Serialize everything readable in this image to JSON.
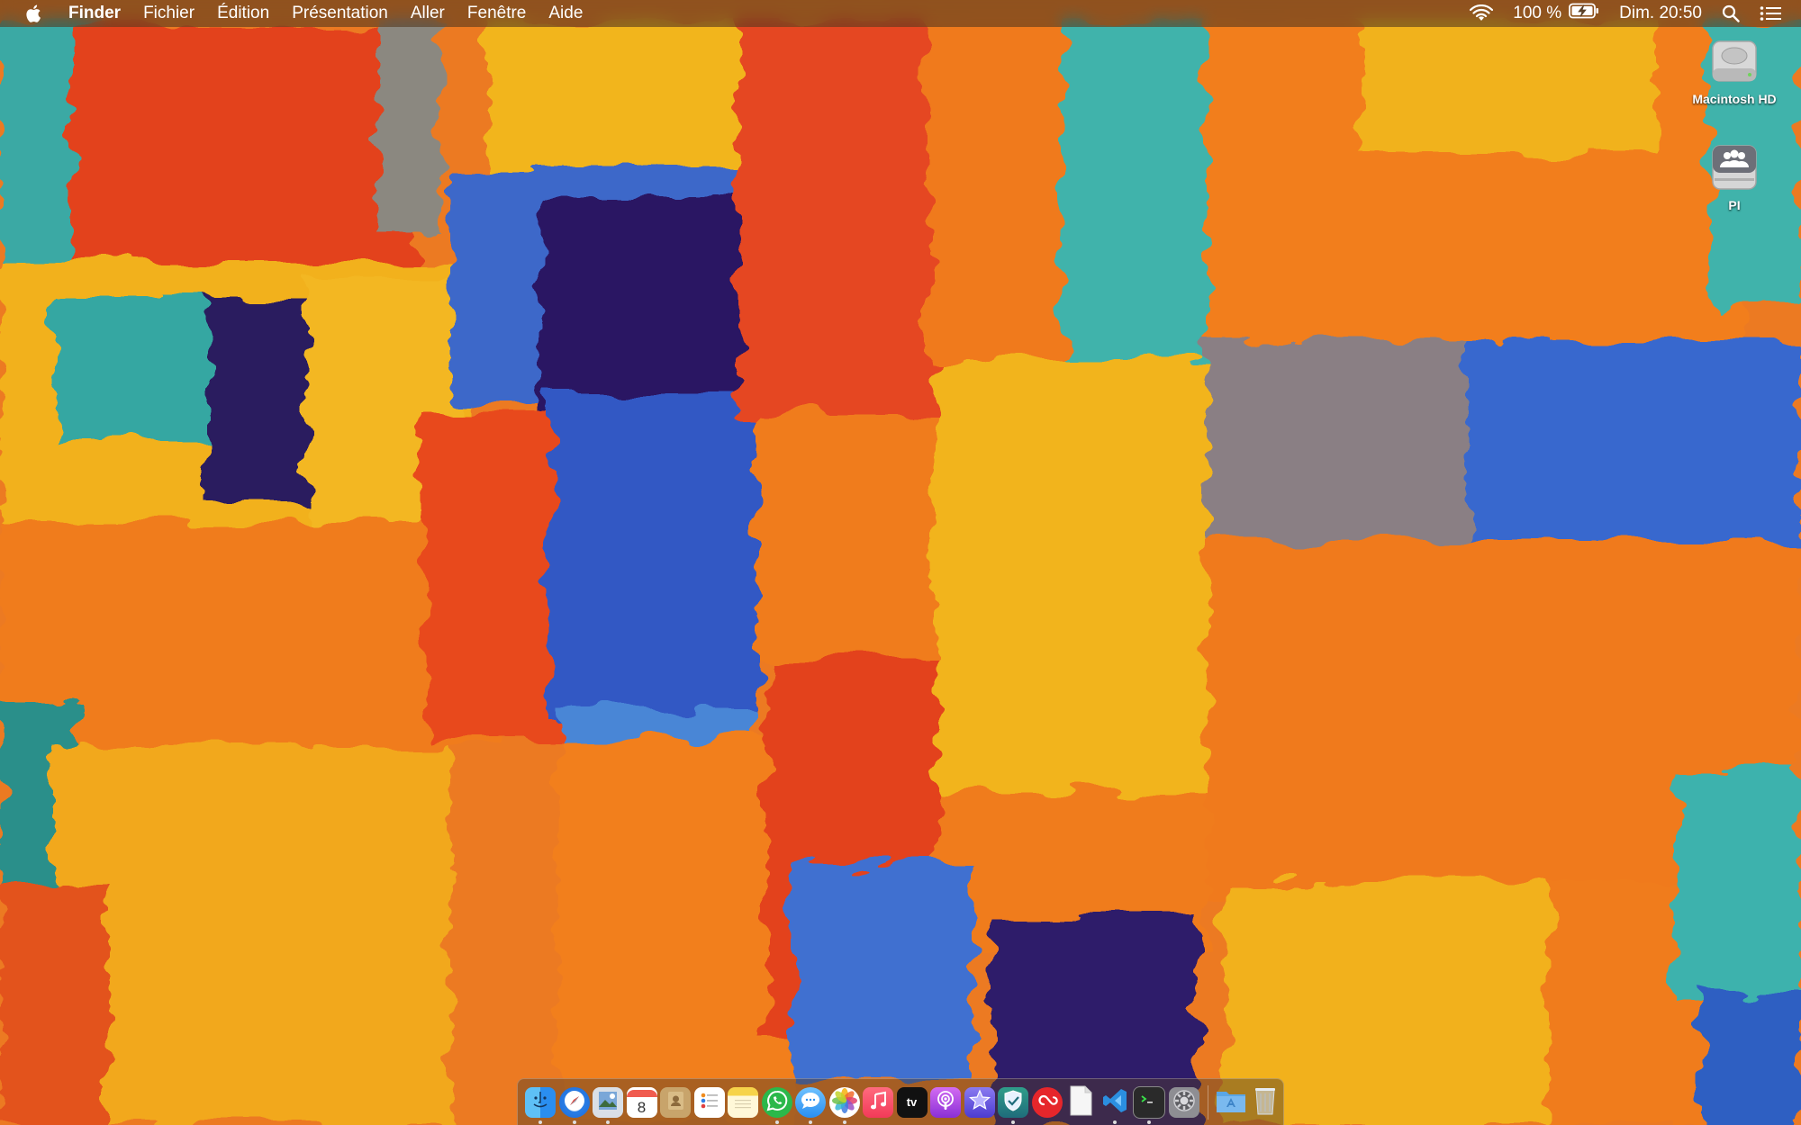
{
  "menubar": {
    "app_name": "Finder",
    "items": [
      "Fichier",
      "Édition",
      "Présentation",
      "Aller",
      "Fenêtre",
      "Aide"
    ],
    "battery_percent": "100 %",
    "datetime": "Dim. 20:50"
  },
  "desktop": {
    "icons": [
      {
        "label": "Macintosh HD",
        "icon": "hard-drive-icon"
      },
      {
        "label": "PI",
        "icon": "network-share-icon"
      }
    ]
  },
  "dock": {
    "apps": [
      {
        "icon": "finder-icon",
        "running": true
      },
      {
        "icon": "safari-icon",
        "running": true
      },
      {
        "icon": "preview-icon",
        "running": true
      },
      {
        "icon": "calendar-icon",
        "running": false,
        "text": "8"
      },
      {
        "icon": "contacts-icon",
        "running": false
      },
      {
        "icon": "reminders-icon",
        "running": false
      },
      {
        "icon": "notes-icon",
        "running": false
      },
      {
        "icon": "whatsapp-icon",
        "running": true
      },
      {
        "icon": "messages-icon",
        "running": true
      },
      {
        "icon": "photos-icon",
        "running": true
      },
      {
        "icon": "music-icon",
        "running": false
      },
      {
        "icon": "apple-tv-icon",
        "running": false,
        "text": "tv"
      },
      {
        "icon": "podcasts-icon",
        "running": false
      },
      {
        "icon": "imovie-icon",
        "running": false
      },
      {
        "icon": "vpn-shield-icon",
        "running": true
      },
      {
        "icon": "creative-cloud-icon",
        "running": false
      },
      {
        "icon": "text-file-icon",
        "running": false
      },
      {
        "icon": "vscode-icon",
        "running": true
      },
      {
        "icon": "terminal-icon",
        "running": true
      },
      {
        "icon": "system-preferences-icon",
        "running": false
      }
    ],
    "trailing": [
      {
        "icon": "applications-folder-icon"
      },
      {
        "icon": "trash-icon"
      }
    ]
  },
  "colors": {
    "orange": "#f07a1a",
    "red": "#e2401d",
    "yellow": "#f2b11c",
    "teal": "#3db6b0",
    "blue": "#2f63c8",
    "purple": "#3b2174"
  }
}
